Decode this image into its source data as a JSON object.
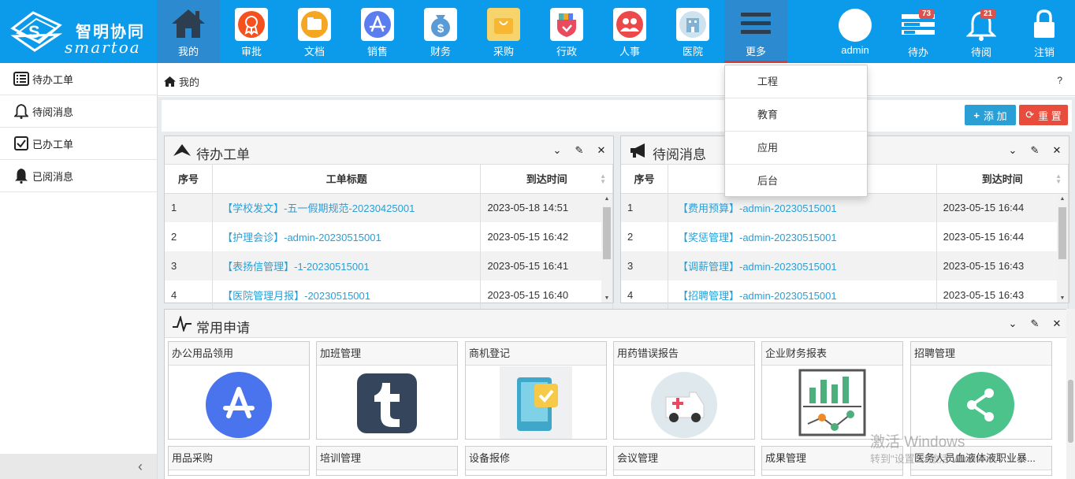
{
  "header": {
    "logo_cn": "智明协同",
    "logo_en": "smartoa",
    "nav": [
      {
        "label": "我的",
        "icon": "home-icon",
        "color": "#2d3e50"
      },
      {
        "label": "审批",
        "icon": "award-icon",
        "color": "#f4511e"
      },
      {
        "label": "文档",
        "icon": "folder-icon",
        "color": "#f5a623"
      },
      {
        "label": "销售",
        "icon": "appstore-icon",
        "color": "#5b7df0"
      },
      {
        "label": "财务",
        "icon": "money-bag-icon",
        "color": "#5b9bd5"
      },
      {
        "label": "采购",
        "icon": "shopping-bag-icon",
        "color": "#f7b733"
      },
      {
        "label": "行政",
        "icon": "shield-icon",
        "color": "#e84a5f"
      },
      {
        "label": "人事",
        "icon": "people-icon",
        "color": "#ec4a4a"
      },
      {
        "label": "医院",
        "icon": "hospital-icon",
        "color": "#7fb3d5"
      },
      {
        "label": "更多",
        "icon": "menu-icon",
        "color": "#2d3e50"
      }
    ],
    "user": {
      "label": "admin"
    },
    "todo": {
      "label": "待办",
      "count": "73"
    },
    "unread": {
      "label": "待阅",
      "count": "21"
    },
    "logout": {
      "label": "注销"
    }
  },
  "more_menu": [
    "工程",
    "教育",
    "应用",
    "后台"
  ],
  "sidebar": {
    "items": [
      {
        "label": "待办工单",
        "icon": "list-icon"
      },
      {
        "label": "待阅消息",
        "icon": "bell-outline-icon"
      },
      {
        "label": "已办工单",
        "icon": "checkbox-icon"
      },
      {
        "label": "已阅消息",
        "icon": "bell-solid-icon"
      }
    ]
  },
  "breadcrumb": {
    "label": "我的",
    "help": "?"
  },
  "toolbar": {
    "add_label": "添 加",
    "reset_label": "重 置"
  },
  "todo_panel": {
    "title": "待办工单",
    "columns": [
      "序号",
      "工单标题",
      "到达时间"
    ],
    "rows": [
      {
        "no": "1",
        "title": "【学校发文】-五一假期规范-20230425001",
        "time": "2023-05-18 14:51"
      },
      {
        "no": "2",
        "title": "【护理会诊】-admin-20230515001",
        "time": "2023-05-15 16:42"
      },
      {
        "no": "3",
        "title": "【表扬信管理】-1-20230515001",
        "time": "2023-05-15 16:41"
      },
      {
        "no": "4",
        "title": "【医院管理月报】-20230515001",
        "time": "2023-05-15 16:40"
      }
    ]
  },
  "msg_panel": {
    "title": "待阅消息",
    "columns": [
      "序号",
      "",
      "到达时间"
    ],
    "rows": [
      {
        "no": "1",
        "title": "【费用预算】-admin-20230515001",
        "time": "2023-05-15 16:44"
      },
      {
        "no": "2",
        "title": "【奖惩管理】-admin-20230515001",
        "time": "2023-05-15 16:44"
      },
      {
        "no": "3",
        "title": "【调薪管理】-admin-20230515001",
        "time": "2023-05-15 16:43"
      },
      {
        "no": "4",
        "title": "【招聘管理】-admin-20230515001",
        "time": "2023-05-15 16:43"
      }
    ]
  },
  "apps_panel": {
    "title": "常用申请",
    "apps_row1": [
      {
        "name": "办公用品领用",
        "icon": "appstore-circle-icon"
      },
      {
        "name": "加班管理",
        "icon": "tumblr-icon"
      },
      {
        "name": "商机登记",
        "icon": "tablet-check-icon"
      },
      {
        "name": "用药错误报告",
        "icon": "ambulance-icon"
      },
      {
        "name": "企业财务报表",
        "icon": "chart-report-icon"
      },
      {
        "name": "招聘管理",
        "icon": "share-circle-icon"
      }
    ],
    "apps_row2": [
      {
        "name": "用品采购"
      },
      {
        "name": "培训管理"
      },
      {
        "name": "设备报修"
      },
      {
        "name": "会议管理"
      },
      {
        "name": "成果管理"
      },
      {
        "name": "医务人员血液体液职业暴..."
      }
    ]
  },
  "watermark": {
    "line1": "激活 Windows",
    "line2": "转到\"设置\"以激活 Windows。"
  }
}
